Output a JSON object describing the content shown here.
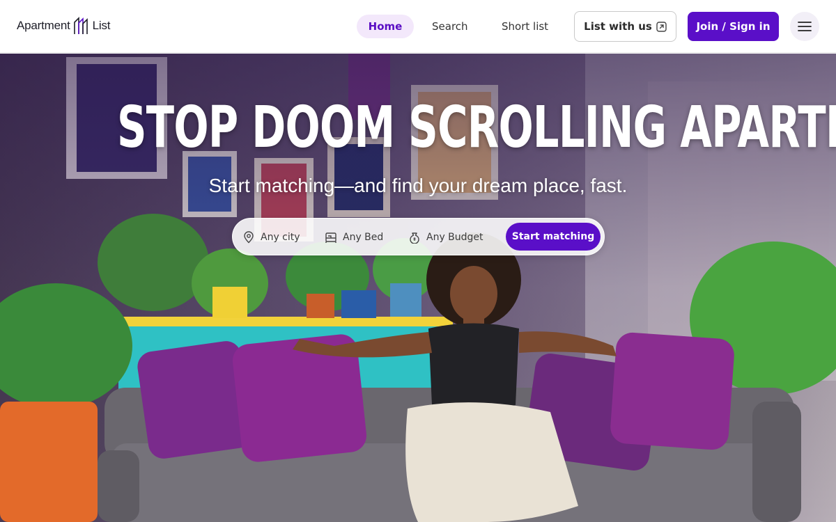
{
  "header": {
    "logo": {
      "text_left": "Apartment",
      "text_right": "List"
    },
    "nav": {
      "home": "Home",
      "search": "Search",
      "short_list": "Short list",
      "list_with_us": "List with us",
      "join": "Join / Sign in"
    },
    "icons": {
      "external": "external-link-icon",
      "menu": "hamburger-menu-icon"
    }
  },
  "hero": {
    "headline": "STOP DOOM SCROLLING APARTMENTS.",
    "subheadline": "Start matching—and find your dream place, fast.",
    "search": {
      "city": "Any city",
      "bed": "Any Bed",
      "budget": "Any Budget",
      "cta": "Start matching"
    },
    "icons": {
      "city": "location-pin-icon",
      "bed": "bed-icon",
      "budget": "money-bag-icon"
    }
  },
  "colors": {
    "brand_purple": "#5a0fc8",
    "home_pill_bg": "#f3e8fb",
    "header_bg": "#ffffff"
  }
}
